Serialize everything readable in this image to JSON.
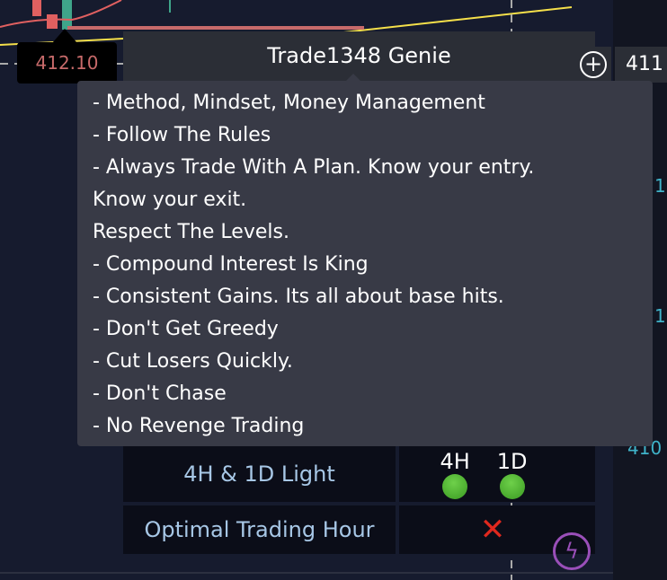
{
  "chart": {
    "price_label": "412.10",
    "current_price": "411",
    "axis_labels": [
      "1",
      "1",
      "410"
    ],
    "colors": {
      "up": "#3fa58a",
      "down": "#e06060",
      "ma_yellow": "#f5e04a",
      "axis_text": "#3fb3c9"
    }
  },
  "indicator": {
    "title": "Trade1348 Genie",
    "tooltip_lines": [
      "- Method, Mindset, Money Management",
      "- Follow The Rules",
      "- Always Trade With A Plan. Know your entry.",
      "Know your exit.",
      "Respect The Levels.",
      "- Compound Interest Is King",
      "- Consistent Gains. Its all about base hits.",
      "- Don't Get Greedy",
      "- Cut Losers Quickly.",
      "- Don't Chase",
      "- No Revenge Trading"
    ],
    "table": [
      {
        "label": "4H & 1D Light",
        "tf1": "4H",
        "tf2": "1D",
        "status1": "green",
        "status2": "green"
      },
      {
        "label": "Optimal Trading Hour",
        "status": "cross-icon"
      }
    ]
  }
}
